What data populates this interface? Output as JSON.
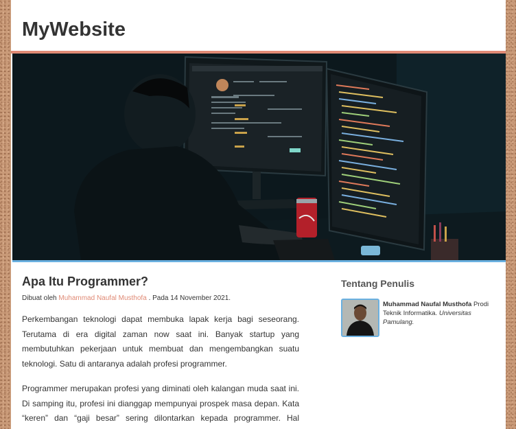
{
  "header": {
    "site_title": "MyWebsite"
  },
  "hero": {
    "image_alt": "Programmer working at desk with two monitors showing code"
  },
  "article": {
    "title": "Apa Itu Programmer?",
    "meta_prefix": "Dibuat oleh ",
    "author_name": "Muhammad Naufal Musthofa",
    "meta_suffix": ". Pada 14 November 2021.",
    "paragraphs": [
      "Perkembangan teknologi dapat membuka lapak kerja bagi seseorang. Terutama di era digital zaman now saat ini. Banyak startup yang membutuhkan pekerjaan untuk membuat dan mengembangkan suatu teknologi. Satu di antaranya adalah profesi programmer.",
      "Programmer merupakan profesi yang diminati oleh kalangan muda saat ini. Di samping itu, profesi ini dianggap mempunyai prospek masa depan. Kata “keren” dan “gaji besar” sering dilontarkan kepada programmer. Hal tersebut"
    ]
  },
  "sidebar": {
    "title": "Tentang Penulis",
    "author_name": "Muhammad Naufal Musthofa",
    "author_desc": " Prodi Teknik Informatika. ",
    "author_university": "Universitas Pamulang."
  },
  "colors": {
    "accent": "#e08a75",
    "hero_border": "#6ab0e0",
    "background": "#c99a78"
  }
}
